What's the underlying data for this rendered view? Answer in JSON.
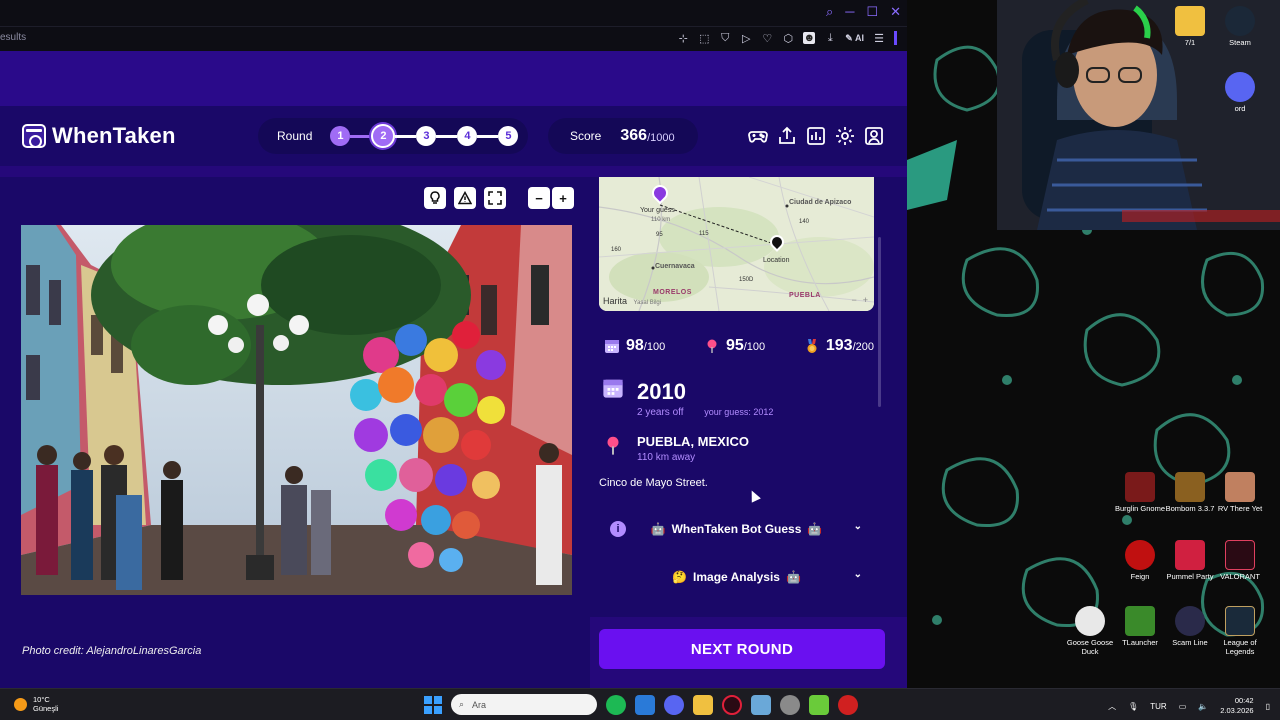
{
  "browser": {
    "tab_fragment": "esults",
    "extension_ai_label": "AI"
  },
  "app": {
    "name": "WhenTaken",
    "round_label": "Round",
    "rounds": [
      "1",
      "2",
      "3",
      "4",
      "5"
    ],
    "current_round": 2,
    "score_label": "Score",
    "score_value": "366",
    "score_max": "/1000",
    "header_icons": [
      "gamepad-icon",
      "share-icon",
      "stats-icon",
      "settings-icon",
      "profile-icon"
    ]
  },
  "photo": {
    "credit": "Photo credit: AlejandroLinaresGarcia",
    "tools": [
      "hint-icon",
      "report-icon",
      "fullscreen-icon",
      "zoom-out-icon",
      "zoom-in-icon"
    ]
  },
  "map": {
    "labels": {
      "your_guess": "Your guess",
      "city_apizaco": "Ciudad de Apizaco",
      "location": "Location",
      "cuernavaca": "Cuernavaca",
      "morelos": "MORELOS",
      "puebla_state": "PUEBLA",
      "brand": "Harita",
      "legal": "Yasal Bilgi",
      "road_95": "95",
      "road_115": "115",
      "road_140": "140",
      "road_150": "150D",
      "road_160": "160",
      "small_note": "110 km"
    }
  },
  "results": {
    "year_score": "98",
    "year_max": "/100",
    "location_score": "95",
    "location_max": "/100",
    "total_score": "193",
    "total_max": "/200",
    "year": "2010",
    "year_off": "2 years off",
    "year_guess": "your guess: 2012",
    "location": "PUEBLA, MEXICO",
    "distance": "110 km away",
    "description": "Cinco de Mayo Street.",
    "bot_guess_label": "WhenTaken Bot Guess",
    "image_analysis_label": "Image Analysis",
    "next_round_label": "NEXT ROUND"
  },
  "desktop": {
    "icons": [
      {
        "label": "7/1",
        "color": "#f0c040"
      },
      {
        "label": "Steam",
        "color": "#1b2838"
      },
      {
        "label": "ord",
        "color": "#5865f2"
      },
      {
        "label": "Burglin Gnome",
        "color": "#7a1a1a"
      },
      {
        "label": "Bombom 3.3.7",
        "color": "#8a6020"
      },
      {
        "label": "RV There Yet",
        "color": "#c08060"
      },
      {
        "label": "Feign",
        "color": "#c01010"
      },
      {
        "label": "Pummel Party",
        "color": "#d02040"
      },
      {
        "label": "VALORANT",
        "color": "#2a0a14"
      },
      {
        "label": "Goose Goose Duck",
        "color": "#e8e8e8"
      },
      {
        "label": "TLauncher",
        "color": "#3a8a2a"
      },
      {
        "label": "Scam Line",
        "color": "#2a2a4a"
      },
      {
        "label": "League of Legends",
        "color": "#1a2a3a"
      }
    ]
  },
  "taskbar": {
    "temperature": "10°C",
    "weather": "Güneşli",
    "search_placeholder": "Ara",
    "language": "TUR",
    "time": "00:42",
    "date": "2.03.2026",
    "apps": [
      {
        "name": "spotify-icon",
        "color": "#1db954"
      },
      {
        "name": "mail-icon",
        "color": "#2a7ad8"
      },
      {
        "name": "discord-icon",
        "color": "#5865f2"
      },
      {
        "name": "folder-icon",
        "color": "#f0c040"
      },
      {
        "name": "opera-gx-icon",
        "color": "#e0203a"
      },
      {
        "name": "app-icon-a",
        "color": "#6aa8d8"
      },
      {
        "name": "app-icon-b",
        "color": "#8a8a8a"
      },
      {
        "name": "app-icon-c",
        "color": "#6acb3a"
      },
      {
        "name": "app-icon-d",
        "color": "#d02020"
      }
    ]
  },
  "colors": {
    "accent": "#6a10f0",
    "app_bg": "#1a0868",
    "highlight": "#b28cff"
  }
}
